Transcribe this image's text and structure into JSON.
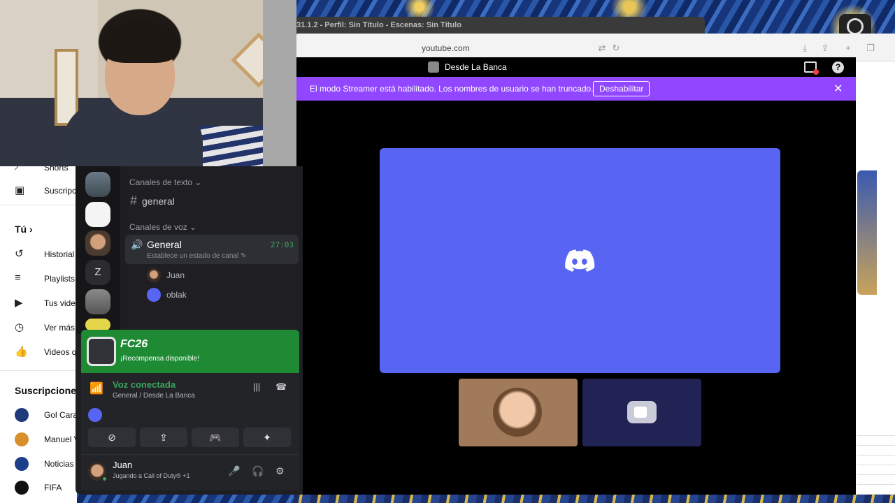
{
  "obs": {
    "title": "31.1.2 - Perfil: Sin Título - Escenas: Sin Título"
  },
  "browser": {
    "url": "youtube.com"
  },
  "discord": {
    "header_title": "Desde La Banca",
    "streamer_banner": {
      "text": "El modo Streamer está habilitado. Los nombres de usuario se han truncado.",
      "button": "Deshabilitar",
      "close": "✕"
    },
    "help": "?",
    "channels": {
      "text_category": "Canales de texto",
      "text_channel": "general",
      "voice_category": "Canales de voz",
      "voice_channel": {
        "name": "General",
        "timer": "27:03",
        "status_placeholder": "Establece un estado de canal"
      },
      "voice_users": [
        "Juan",
        "oblak"
      ]
    },
    "guild_letter": "Z",
    "promo": {
      "title": "FC26",
      "subtitle": "¡Recompensa disponible!"
    },
    "voice_connected": {
      "title": "Voz conectada",
      "subtitle": "General / Desde La Banca"
    },
    "user": {
      "name": "Juan",
      "status": "Jugando a Call of Duty® +1"
    }
  },
  "youtube_sidebar": {
    "items_top": [
      {
        "icon": "shorts-icon",
        "label": "Shorts"
      },
      {
        "icon": "subscriptions-icon",
        "label": "Suscripc"
      }
    ],
    "you_header": "Tú",
    "items_you": [
      {
        "icon": "history-icon",
        "label": "Historial"
      },
      {
        "icon": "playlists-icon",
        "label": "Playlists"
      },
      {
        "icon": "your-videos-icon",
        "label": "Tus vide"
      },
      {
        "icon": "watch-later-icon",
        "label": "Ver más"
      },
      {
        "icon": "liked-icon",
        "label": "Videos q"
      }
    ],
    "subs_header": "Suscripciones",
    "subs": [
      {
        "label": "Gol Cara",
        "color": "#1f3b7a"
      },
      {
        "label": "Manuel V",
        "color": "#d9902c"
      },
      {
        "label": "Noticias",
        "color": "#1c3f8a"
      },
      {
        "label": "FIFA",
        "color": "#111111"
      }
    ]
  },
  "colors": {
    "blurple": "#5865f2",
    "streamer": "#9147ff",
    "voice_green": "#3ba55d",
    "promo_green": "#1e8a34"
  }
}
